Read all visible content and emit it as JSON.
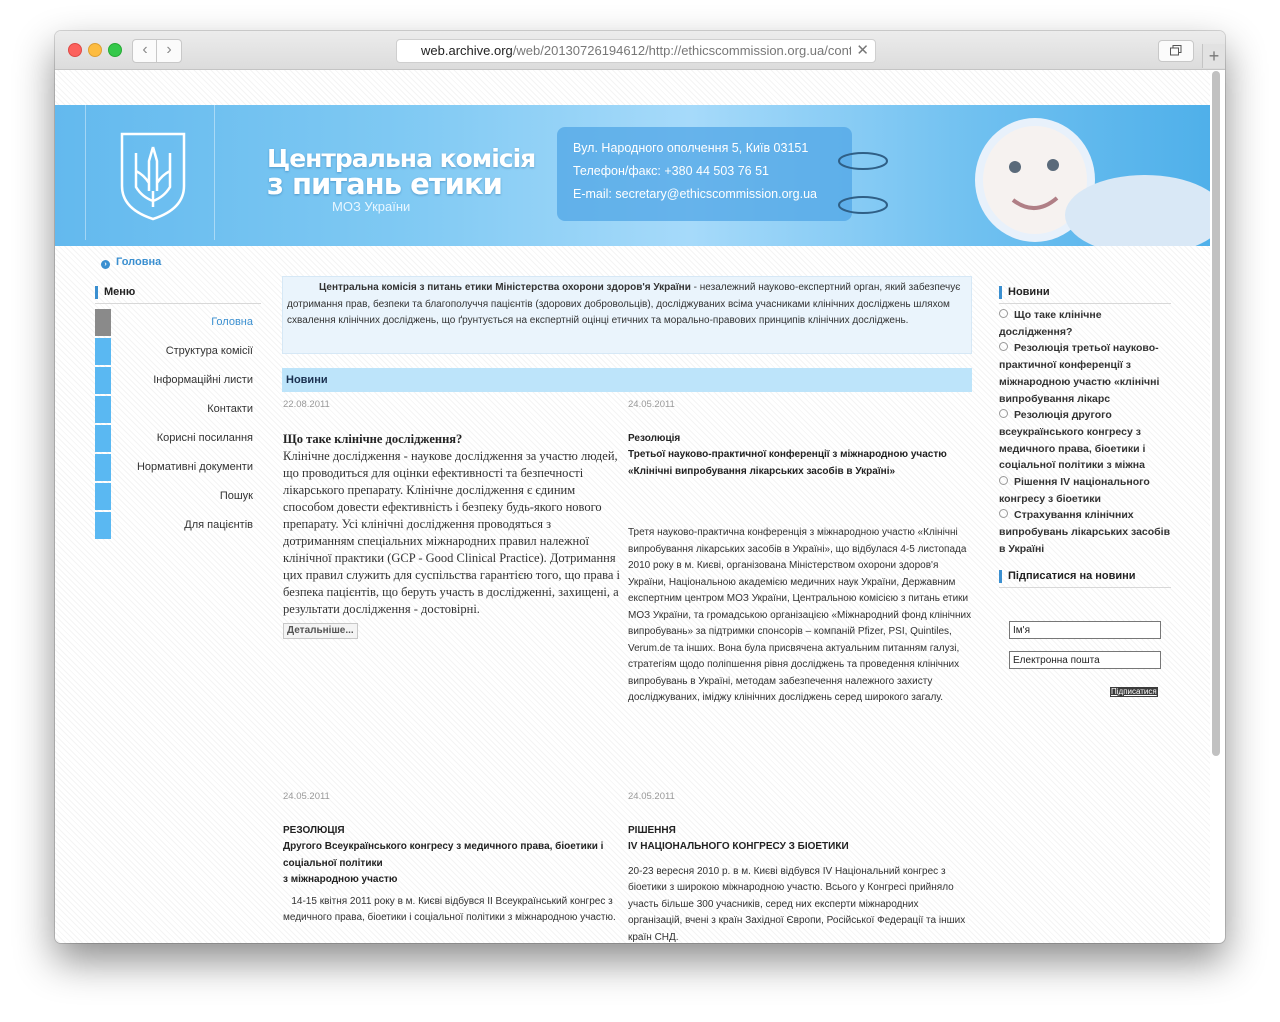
{
  "browser": {
    "url_host": "web.archive.org",
    "url_rest": "/web/20130726194612/http://ethicscommission.org.ua/conte",
    "back_glyph": "‹",
    "forward_glyph": "›",
    "close_glyph": "✕",
    "new_tab_glyph": "+"
  },
  "header": {
    "title_line1": "Центральна комісія",
    "title_line2": "з питань етики",
    "subtitle": "МОЗ України",
    "address": "Вул. Народного ополчення 5, Київ 03151",
    "phone": "Телефон/факс: +380 44 503 76 51",
    "email": "E-mail: secretary@ethicscommission.org.ua"
  },
  "breadcrumb": {
    "item": "Головна",
    "icon_glyph": "›"
  },
  "menu": {
    "title": "Меню",
    "items": [
      {
        "label": "Головна"
      },
      {
        "label": "Структура комісії"
      },
      {
        "label": "Інформаційні листи"
      },
      {
        "label": "Контакти"
      },
      {
        "label": "Корисні посилання"
      },
      {
        "label": "Нормативні документи"
      },
      {
        "label": "Пошук"
      },
      {
        "label": "Для пацієнтів"
      }
    ]
  },
  "intro": {
    "bold": "Центральна комісія з питань етики Міністерства охорони здоров'я України",
    "text": " - незалежний науково-експертний орган, який забезпечує дотримання прав, безпеки та благополуччя пацієнтів (здорових добровольців), досліджуваних всіма учасниками клінічних досліджень шляхом схвалення клінічних досліджень, що ґрунтується на експертній оцінці етичних та морально-правових принципів клінічних досліджень."
  },
  "news": {
    "title": "Новини",
    "items": [
      {
        "date": "22.08.2011",
        "title": "Що таке клінічне дослідження?",
        "body": "Клінічне дослідження - наукове дослідження за участю людей, що проводиться для оцінки ефективності та безпечності лікарського препарату. Клінічне дослідження є єдиним способом довести ефективність і безпеку будь-якого нового препарату. Усі клінічні дослідження проводяться з дотриманням спеціальних міжнародних правил належної клінічної практики (GCP - Good Clinical Practice). Дотримання цих правил служить для суспільства гарантією того, що права і безпека пацієнтів, що беруть участь в дослідженні, захищені, а результати дослідження - достовірні.",
        "more": "Детальніше..."
      },
      {
        "date": "24.05.2011",
        "title_l1": "Резолюція",
        "title_l2": "Третьої науково-практичної конференції з міжнародною участю",
        "title_l3": "«Клінічні випробування лікарських засобів в Україні»",
        "body": "Третя науково-практична конференція з міжнародною участю «Клінічні випробування лікарських засобів в Україні», що відбулася 4-5 листопада 2010 року в м. Києві, організована Міністерством охорони здоров'я України, Національною академією медичних наук України, Державним експертним центром МОЗ України, Центральною комісією з питань етики МОЗ України, та громадською організацією «Міжнародний фонд клінічних випробувань» за підтримки спонсорів – компаній Pfizer, PSI, Quintiles, Verum.de та інших. Вона була присвячена актуальним питанням галузі, стратегіям щодо поліпшення рівня досліджень та проведення клінічних випробувань в Україні, методам забезпечення належного захисту досліджуваних, іміджу клінічних досліджень серед широкого загалу."
      },
      {
        "date": "24.05.2011",
        "title_l1": "РЕЗОЛЮЦІЯ",
        "title_l2": "Другого Всеукраїнського конгресу з медичного права, біоетики і соціальної політики",
        "title_l3": "з міжнародною участю",
        "body": "   14-15 квітня 2011 року в м. Києві відбувся II Всеукраїнський конгрес з медичного права, біоетики і соціальної політики з міжнародною участю."
      },
      {
        "date": "24.05.2011",
        "title_l1": "РІШЕННЯ",
        "title_l2": "IV НАЦІОНАЛЬНОГО КОНГРЕСУ З БІОЕТИКИ",
        "body": "20-23 вересня 2010 р. в м. Києві відбувся IV Національний конгрес з біоетики з широкою міжнародною участю. Всього у Конгресі прийняло участь більше 300 учасників, серед них експерти міжнародних організацій, вчені з країн Західної Європи, Російської Федерації та інших країн СНД."
      }
    ]
  },
  "right_news": {
    "title": "Новини",
    "items": [
      {
        "label": "Що таке клінічне дослідження?"
      },
      {
        "label": "Резолюція третьої науково-практичної конференції з міжнародною участю «клінічні випробування лікарс"
      },
      {
        "label": "Резолюція другого всеукраїнського конгресу з медичного права, біоетики і соціальної політики з міжна"
      },
      {
        "label": "Рішення IV національного конгресу з біоетики"
      },
      {
        "label": "Страхування клінічних випробувань лікарських засобів в Україні"
      }
    ]
  },
  "subscribe": {
    "title": "Підписатися на новини",
    "name_value": "Ім'я",
    "email_value": "Електронна пошта",
    "button": "Підписатися"
  },
  "colors": {
    "accent": "#3a8fd0",
    "menu_tab": "#5ab8f2",
    "news_bar": "#bde4fa",
    "intro_bg": "#eaf4fc"
  }
}
